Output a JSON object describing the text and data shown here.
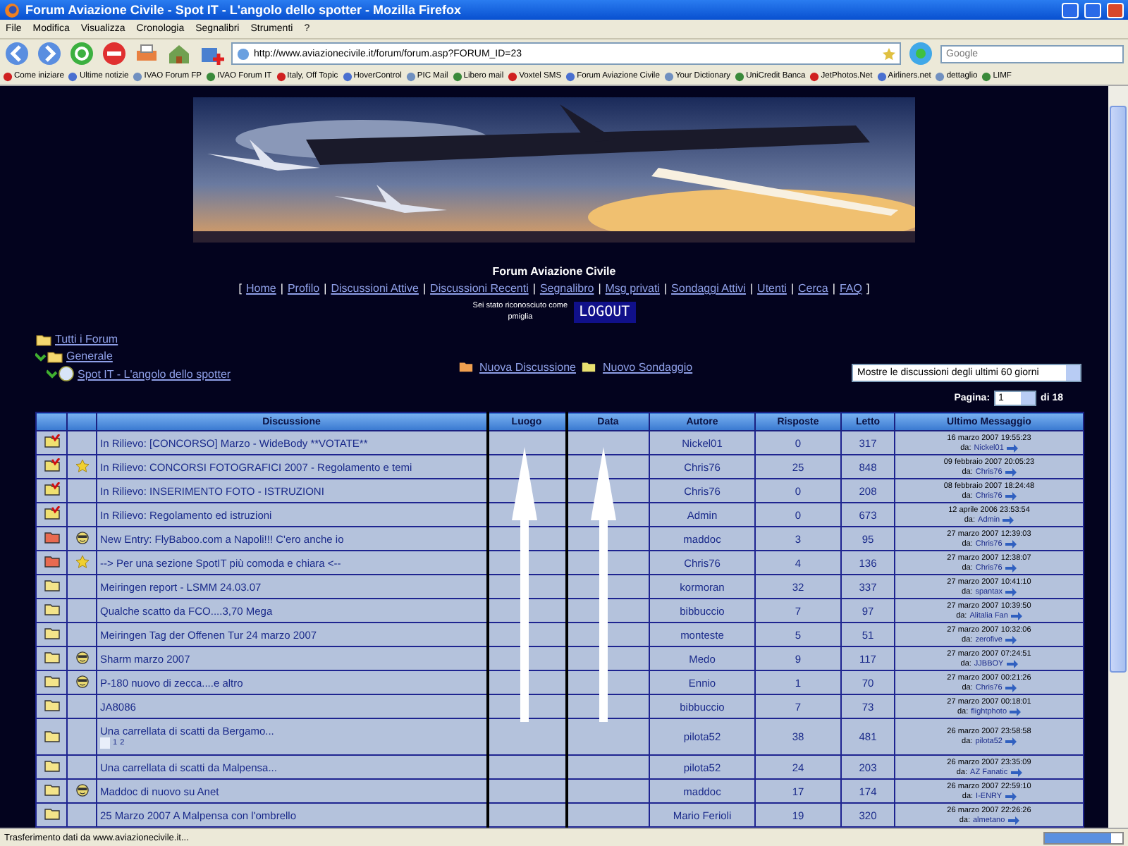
{
  "window": {
    "title": "Forum Aviazione Civile - Spot IT - L'angolo dello spotter - Mozilla Firefox"
  },
  "menu": [
    "File",
    "Modifica",
    "Visualizza",
    "Cronologia",
    "Segnalibri",
    "Strumenti",
    "?"
  ],
  "address": {
    "value": "http://www.aviazionecivile.it/forum/forum.asp?FORUM_ID=23"
  },
  "search": {
    "placeholder": "Google"
  },
  "bookmarks": [
    "Come iniziare",
    "Ultime notizie",
    "IVAO Forum FP",
    "IVAO Forum IT",
    "Italy, Off Topic",
    "HoverControl",
    "PIC Mail",
    "Libero mail",
    "Voxtel SMS",
    "Forum Aviazione Civile",
    "Your Dictionary",
    "UniCredit Banca",
    "JetPhotos.Net",
    "Airliners.net",
    "dettaglio",
    "LIMF"
  ],
  "page": {
    "banner": {
      "kind": "picture"
    },
    "site_title": "Forum Aviazione Civile",
    "nav": [
      {
        "kind": "bracket",
        "text": "["
      },
      {
        "kind": "link",
        "text": "Home"
      },
      {
        "kind": "separator",
        "text": "|"
      },
      {
        "kind": "link",
        "text": "Profilo"
      },
      {
        "kind": "separator",
        "text": "|"
      },
      {
        "kind": "link",
        "text": "Discussioni Attive"
      },
      {
        "kind": "separator",
        "text": "|"
      },
      {
        "kind": "link",
        "text": "Discussioni Recenti"
      },
      {
        "kind": "separator",
        "text": "|"
      },
      {
        "kind": "link",
        "text": "Segnalibro"
      },
      {
        "kind": "separator",
        "text": "|"
      },
      {
        "kind": "link",
        "text": "Msg privati"
      },
      {
        "kind": "separator",
        "text": "|"
      },
      {
        "kind": "link",
        "text": "Sondaggi Attivi"
      },
      {
        "kind": "separator",
        "text": "|"
      },
      {
        "kind": "link",
        "text": "Utenti"
      },
      {
        "kind": "separator",
        "text": "|"
      },
      {
        "kind": "link",
        "text": "Cerca"
      },
      {
        "kind": "separator",
        "text": "|"
      },
      {
        "kind": "link",
        "text": "FAQ"
      },
      {
        "kind": "bracket",
        "text": "]"
      }
    ],
    "login": {
      "line1": "Sei stato riconosciuto come",
      "user": "pmiglia",
      "button": "LOGOUT"
    },
    "breadcrumb": [
      {
        "label": "Tutti i Forum",
        "kind": "root"
      },
      {
        "label": "Generale",
        "kind": "category"
      },
      {
        "label": "Spot IT - L'angolo dello spotter",
        "kind": "forum"
      }
    ],
    "actions": [
      "Nuova Discussione",
      "Nuovo Sondaggio"
    ],
    "filter": {
      "value": "Mostre le discussioni degli ultimi 60 giorni"
    },
    "pager": {
      "label": "Pagina:",
      "value": "1",
      "total": "di 18"
    }
  },
  "table": {
    "columns": [
      "Discussione",
      "Luogo",
      "Data",
      "Autore",
      "Risposte",
      "Letto",
      "Ultimo Messaggio"
    ],
    "rows": [
      {
        "kind": "sticky",
        "topic": "In Rilievo: [CONCORSO] Marzo - WideBody **VOTATE**",
        "author": "Nickel01",
        "replies": "0",
        "views": "317",
        "last_date": "16 marzo 2007  19:55:23",
        "last_prefix": "da:",
        "last_by": "Nickel01"
      },
      {
        "kind": "sticky",
        "emblem": {
          "kind": "star"
        },
        "topic": "In Rilievo: CONCORSI FOTOGRAFICI 2007 - Regolamento e temi",
        "author": "Chris76",
        "replies": "25",
        "views": "848",
        "last_date": "09 febbraio 2007  20:05:23",
        "last_prefix": "da:",
        "last_by": "Chris76"
      },
      {
        "kind": "sticky",
        "topic": "In Rilievo: INSERIMENTO FOTO - ISTRUZIONI",
        "author": "Chris76",
        "replies": "0",
        "views": "208",
        "last_date": "08 febbraio 2007  18:24:48",
        "last_prefix": "da:",
        "last_by": "Chris76"
      },
      {
        "kind": "sticky",
        "topic": "In Rilievo: Regolamento ed istruzioni",
        "author": "Admin",
        "replies": "0",
        "views": "673",
        "last_date": "12 aprile 2006  23:53:54",
        "last_prefix": "da:",
        "last_by": "Admin"
      },
      {
        "kind": "hot",
        "emblem": {
          "kind": "smiley"
        },
        "topic": "New Entry: FlyBaboo.com a Napoli!!! C'ero anche io",
        "author": "maddoc",
        "replies": "3",
        "views": "95",
        "last_date": "27 marzo 2007  12:39:03",
        "last_prefix": "da:",
        "last_by": "Chris76"
      },
      {
        "kind": "hot",
        "emblem": {
          "kind": "star"
        },
        "topic": "--> Per una sezione SpotIT più comoda e chiara <--",
        "author": "Chris76",
        "replies": "4",
        "views": "136",
        "last_date": "27 marzo 2007  12:38:07",
        "last_prefix": "da:",
        "last_by": "Chris76"
      },
      {
        "kind": "normal",
        "topic": "Meiringen report - LSMM 24.03.07",
        "author": "kormoran",
        "replies": "32",
        "views": "337",
        "last_date": "27 marzo 2007  10:41:10",
        "last_prefix": "da:",
        "last_by": "spantax"
      },
      {
        "kind": "normal",
        "topic": "Qualche scatto da FCO....3,70 Mega",
        "author": "bibbuccio",
        "replies": "7",
        "views": "97",
        "last_date": "27 marzo 2007  10:39:50",
        "last_prefix": "da:",
        "last_by": "Alitalia Fan"
      },
      {
        "kind": "normal",
        "topic": "Meiringen Tag der Offenen Tur 24 marzo 2007",
        "author": "monteste",
        "replies": "5",
        "views": "51",
        "last_date": "27 marzo 2007  10:32:06",
        "last_prefix": "da:",
        "last_by": "zerofive"
      },
      {
        "kind": "normal",
        "emblem": {
          "kind": "smiley"
        },
        "topic": "Sharm marzo 2007",
        "author": "Medo",
        "replies": "9",
        "views": "117",
        "last_date": "27 marzo 2007  07:24:51",
        "last_prefix": "da:",
        "last_by": "JJBBOY"
      },
      {
        "kind": "normal",
        "emblem": {
          "kind": "smiley"
        },
        "topic": "P-180 nuovo di zecca....e altro",
        "author": "Ennio",
        "replies": "1",
        "views": "70",
        "last_date": "27 marzo 2007  00:21:26",
        "last_prefix": "da:",
        "last_by": "Chris76"
      },
      {
        "kind": "normal",
        "topic": "JA8086",
        "author": "bibbuccio",
        "replies": "7",
        "views": "73",
        "last_date": "27 marzo 2007  00:18:01",
        "last_prefix": "da:",
        "last_by": "flightphoto"
      },
      {
        "kind": "normal",
        "topic": "Una carrellata di scatti da Bergamo...",
        "pages": [
          "1",
          "2"
        ],
        "author": "pilota52",
        "replies": "38",
        "views": "481",
        "last_date": "26 marzo 2007  23:58:58",
        "last_prefix": "da:",
        "last_by": "pilota52"
      },
      {
        "kind": "normal",
        "topic": "Una carrellata di scatti da Malpensa...",
        "author": "pilota52",
        "replies": "24",
        "views": "203",
        "last_date": "26 marzo 2007  23:35:09",
        "last_prefix": "da:",
        "last_by": "AZ Fanatic"
      },
      {
        "kind": "normal",
        "emblem": {
          "kind": "smiley"
        },
        "topic": "Maddoc di nuovo su Anet",
        "author": "maddoc",
        "replies": "17",
        "views": "174",
        "last_date": "26 marzo 2007  22:59:10",
        "last_prefix": "da:",
        "last_by": "I-ENRY"
      },
      {
        "kind": "normal",
        "topic": "25 Marzo 2007 A Malpensa con l'ombrello",
        "author": "Mario Ferioli",
        "replies": "19",
        "views": "320",
        "last_date": "26 marzo 2007  22:26:26",
        "last_prefix": "da:",
        "last_by": "almetano"
      }
    ]
  },
  "status_bar": {
    "text": "Trasferimento dati da www.aviazionecivile.it...",
    "level": 0.85
  }
}
